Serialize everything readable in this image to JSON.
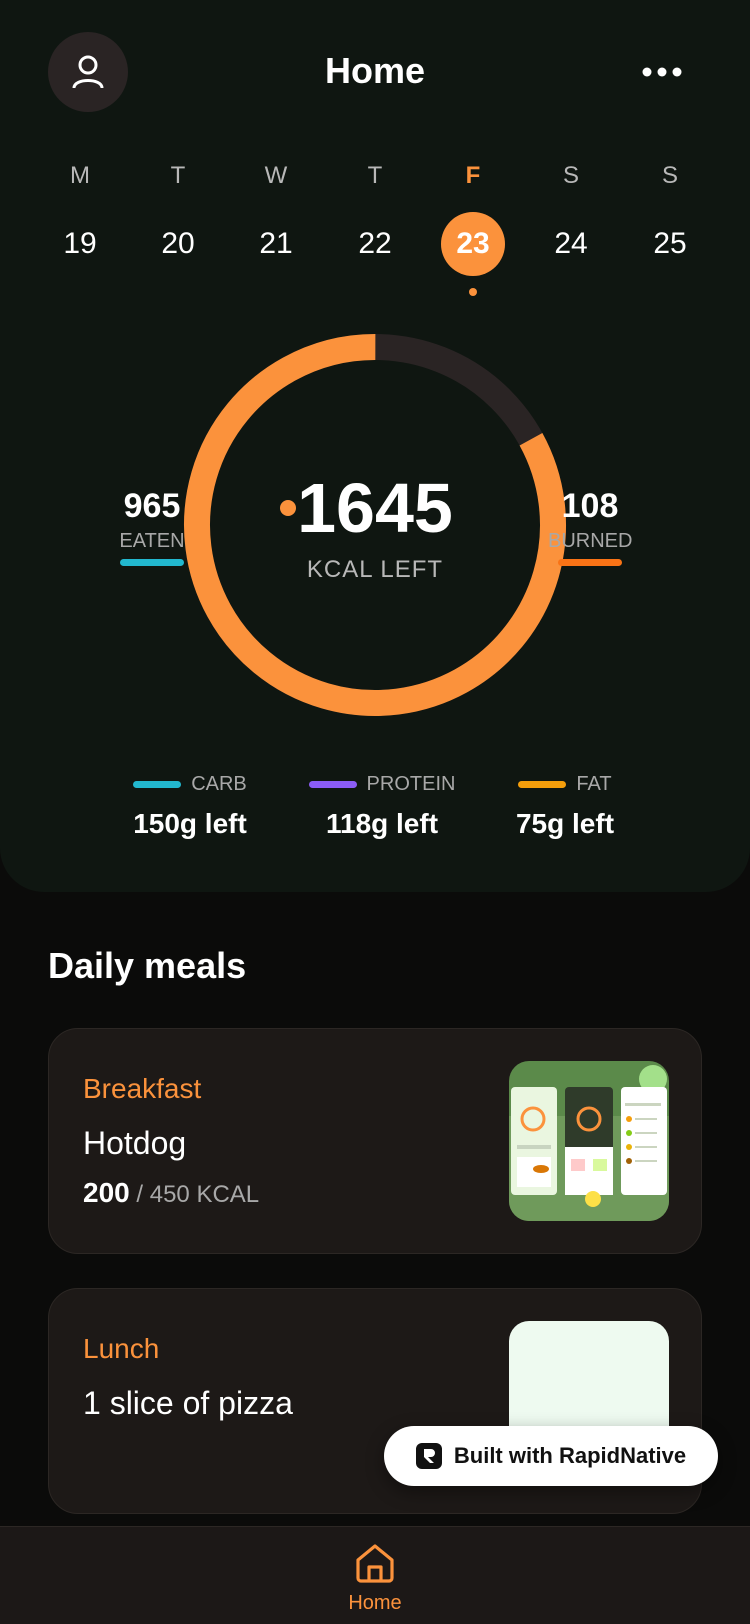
{
  "header": {
    "title": "Home"
  },
  "calendar": {
    "days": [
      {
        "name": "M",
        "date": "19"
      },
      {
        "name": "T",
        "date": "20"
      },
      {
        "name": "W",
        "date": "21"
      },
      {
        "name": "T",
        "date": "22"
      },
      {
        "name": "F",
        "date": "23"
      },
      {
        "name": "S",
        "date": "24"
      },
      {
        "name": "S",
        "date": "25"
      }
    ],
    "selected_index": 4
  },
  "summary": {
    "kcal_left": "1645",
    "kcal_left_label": "KCAL LEFT",
    "eaten_value": "965",
    "eaten_label": "EATEN",
    "burned_value": "108",
    "burned_label": "BURNED",
    "ring_progress_fraction": 0.83
  },
  "macros": [
    {
      "name": "CARB",
      "left": "150g left",
      "color": "#22b8cf"
    },
    {
      "name": "PROTEIN",
      "left": "118g left",
      "color": "#8b5cf6"
    },
    {
      "name": "FAT",
      "left": "75g left",
      "color": "#f59e0b"
    }
  ],
  "meals": {
    "title": "Daily meals",
    "items": [
      {
        "meal": "Breakfast",
        "food": "Hotdog",
        "eaten": "200",
        "target": "/ 450 KCAL"
      },
      {
        "meal": "Lunch",
        "food": "1 slice of pizza"
      }
    ]
  },
  "badge": {
    "text": "Built with RapidNative"
  },
  "tabbar": {
    "home_label": "Home"
  },
  "colors": {
    "accent": "#fb923c",
    "eaten_bar": "#22b8cf",
    "burned_bar": "#f97316",
    "panel": "#0f1611",
    "card": "#1d1917"
  },
  "icons": [
    "user-icon",
    "more-horizontal-icon",
    "home-icon",
    "rapidnative-logo-icon"
  ]
}
